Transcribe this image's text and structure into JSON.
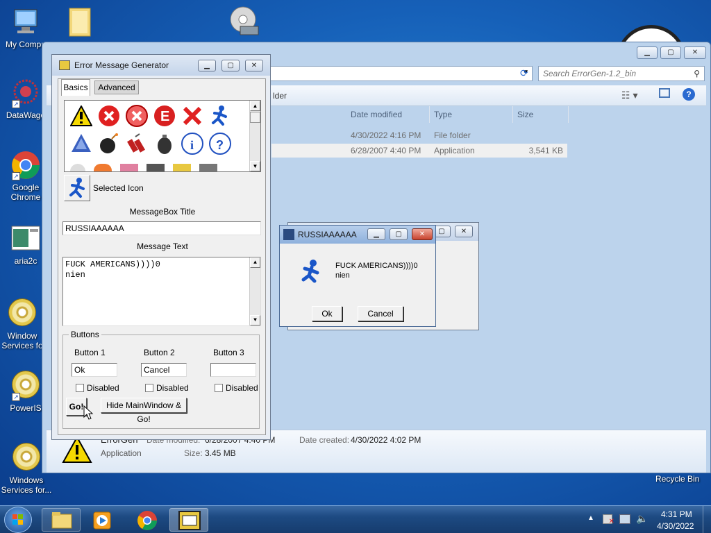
{
  "desktop": {
    "icons": [
      {
        "label": "My Compu",
        "icon": "computer-icon"
      },
      {
        "label": "DataWago",
        "icon": "datawago-icon"
      },
      {
        "label": "Google Chrome",
        "icon": "chrome-icon"
      },
      {
        "label": "aria2c",
        "icon": "aria2c-icon"
      },
      {
        "label": "Window Services fo",
        "icon": "disc-icon"
      },
      {
        "label": "PowerIS",
        "icon": "disc-icon"
      },
      {
        "label": "Windows Services for...",
        "icon": "disc-icon"
      },
      {
        "label": "Recycle Bin",
        "icon": "recycle-bin-icon"
      }
    ]
  },
  "explorer": {
    "search_placeholder": "Search ErrorGen-1.2_bin",
    "sidebar_text": "lder",
    "columns": [
      "Date modified",
      "Type",
      "Size"
    ],
    "rows": [
      {
        "date": "4/30/2022 4:16 PM",
        "type": "File folder",
        "size": ""
      },
      {
        "date": "6/28/2007 4:40 PM",
        "type": "Application",
        "size": "3,541 KB"
      }
    ],
    "details": {
      "name": "ErrorGen",
      "kind": "Application",
      "modified_label": "Date modified:",
      "modified_value": "6/28/2007 4:40 PM",
      "size_label": "Size:",
      "size_value": "3.45 MB",
      "created_label": "Date created:",
      "created_value": "4/30/2022 4:02 PM"
    }
  },
  "generator": {
    "title": "Error Message Generator",
    "tabs": [
      "Basics",
      "Advanced"
    ],
    "selected_icon_label": "Selected Icon",
    "title_label": "MessageBox Title",
    "title_value": "RUSSIAAAAAA",
    "text_label": "Message Text",
    "text_line1": "FUCK AMERICANS))))0",
    "text_line2": "nien",
    "buttons_group": "Buttons",
    "button1_label": "Button 1",
    "button2_label": "Button 2",
    "button3_label": "Button 3",
    "button1_value": "Ok",
    "button2_value": "Cancel",
    "button3_value": "",
    "disabled_label": "Disabled",
    "go_label": "Go!",
    "hide_go_label": "Hide MainWindow & Go!"
  },
  "popup": {
    "title": "RUSSIAAAAAA",
    "line1": "FUCK AMERICANS))))0",
    "line2": "nien",
    "ok_label": "Ok",
    "cancel_label": "Cancel"
  },
  "taskbar": {
    "time": "4:31 PM",
    "date": "4/30/2022"
  }
}
